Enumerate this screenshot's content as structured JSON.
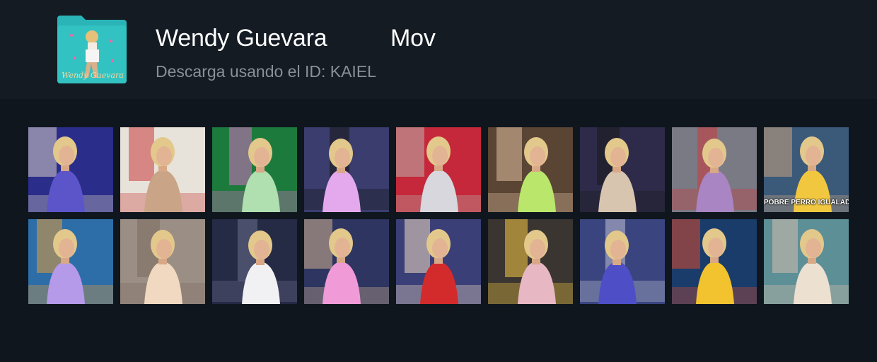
{
  "header": {
    "title": "Wendy Guevara",
    "type_label": "Mov",
    "subtitle": "Descarga usando el ID: KAIEL",
    "folder_icon_text": "Wendy Guevara",
    "folder_color": "#2ab4b7"
  },
  "thumbnails": [
    {
      "scene": "purple robe dancing, red sign",
      "colors": [
        "#2a2d8a",
        "#5b55c9",
        "#d9d0c6"
      ]
    },
    {
      "scene": "red floral top, white room",
      "colors": [
        "#e8e3da",
        "#c9a487",
        "#c93c3c"
      ]
    },
    {
      "scene": "green party lights",
      "colors": [
        "#1d7a3d",
        "#b0e0b0",
        "#d36fc4"
      ]
    },
    {
      "scene": "pink pants, braids, plants",
      "colors": [
        "#3a3d6e",
        "#e3a9ec",
        "#161616"
      ]
    },
    {
      "scene": "white blanket, red couch",
      "colors": [
        "#c5283a",
        "#d7d7dd",
        "#b8b2ac"
      ]
    },
    {
      "scene": "lime tank top, window",
      "colors": [
        "#5a4434",
        "#b9e66b",
        "#e0c0a0"
      ]
    },
    {
      "scene": "black tank top, purple wall",
      "colors": [
        "#2e2b4a",
        "#d8c5b0",
        "#1a1a1a"
      ]
    },
    {
      "scene": "purple dress, bedroom",
      "colors": [
        "#7a7a85",
        "#a985c3",
        "#cc3a3a"
      ]
    },
    {
      "scene": "striped pillows, yellow",
      "colors": [
        "#3b5a7a",
        "#f2c740",
        "#c8a27e"
      ],
      "caption": "POBRE PERRO IGUALADO"
    },
    {
      "scene": "lilac outfit, orange wall",
      "colors": [
        "#2d6ea8",
        "#b49ae8",
        "#e09a3a"
      ]
    },
    {
      "scene": "braids, grey top",
      "colors": [
        "#9b8f85",
        "#f0d9c0",
        "#7b6b60"
      ]
    },
    {
      "scene": "white dress, crowd",
      "colors": [
        "#252a45",
        "#f1f1f4",
        "#6a6e8a"
      ]
    },
    {
      "scene": "pink pants, tropical",
      "colors": [
        "#2d3560",
        "#f09ad8",
        "#d2b18f"
      ]
    },
    {
      "scene": "red varsity jacket",
      "colors": [
        "#3b3f77",
        "#d32b2b",
        "#f2dcc4"
      ]
    },
    {
      "scene": "pink dress, dark room",
      "colors": [
        "#3a3530",
        "#e8b7c4",
        "#f4c743"
      ]
    },
    {
      "scene": "blue hoodie, studio",
      "colors": [
        "#3a4580",
        "#4e4fc7",
        "#c0c0d0"
      ]
    },
    {
      "scene": "yellow jacket, sofa",
      "colors": [
        "#1a3c6a",
        "#f2c32e",
        "#d94a2c"
      ]
    },
    {
      "scene": "teal geometric wall",
      "colors": [
        "#5d8f96",
        "#ece0d0",
        "#d6c0b0"
      ]
    }
  ]
}
